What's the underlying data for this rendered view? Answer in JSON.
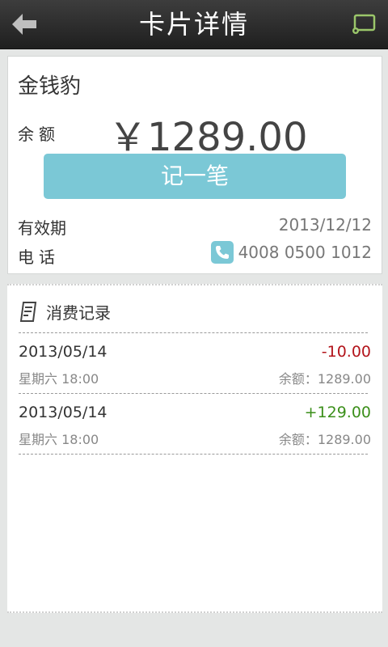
{
  "header": {
    "title": "卡片详情"
  },
  "card": {
    "name": "金钱豹",
    "balance_label": "余额",
    "balance_value": "￥1289.00",
    "record_button": "记一笔",
    "validity_label": "有效期",
    "validity_value": "2013/12/12",
    "phone_label": "电话",
    "phone_value": "4008 0500 1012"
  },
  "records": {
    "title": "消费记录",
    "items": [
      {
        "date": "2013/05/14",
        "weekday_time": "星期六 18:00",
        "amount": "-10.00",
        "balance": "余额：1289.00"
      },
      {
        "date": "2013/05/14",
        "weekday_time": "星期六 18:00",
        "amount": "+129.00",
        "balance": "余额：1289.00"
      }
    ]
  },
  "colors": {
    "accent": "#7bc8d6",
    "negative": "#b3141b",
    "positive": "#3b8f1a"
  }
}
